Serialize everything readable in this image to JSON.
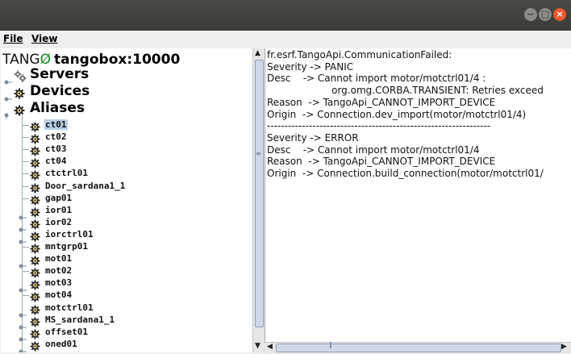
{
  "window": {
    "buttons": {
      "minimize": "−",
      "maximize": "□",
      "close": "×"
    },
    "colors": {
      "titlebar": "#3e3e3b",
      "close": "#e9592c"
    }
  },
  "menubar": {
    "file": "File",
    "view": "View"
  },
  "tree": {
    "logo": "TANGO",
    "root": "tangobox:10000",
    "categories": [
      {
        "label": "Servers",
        "icon": "servers-icon"
      },
      {
        "label": "Devices",
        "icon": "gear-icon"
      },
      {
        "label": "Aliases",
        "icon": "gear-icon"
      }
    ],
    "aliases": [
      {
        "label": "ct01",
        "expandable": false,
        "selected": true
      },
      {
        "label": "ct02",
        "expandable": false
      },
      {
        "label": "ct03",
        "expandable": false
      },
      {
        "label": "ct04",
        "expandable": false
      },
      {
        "label": "ctctrl01",
        "expandable": false
      },
      {
        "label": "Door_sardana1_1",
        "expandable": false
      },
      {
        "label": "gap01",
        "expandable": false
      },
      {
        "label": "ior01",
        "expandable": true
      },
      {
        "label": "ior02",
        "expandable": true
      },
      {
        "label": "iorctrl01",
        "expandable": true
      },
      {
        "label": "mntgrp01",
        "expandable": false
      },
      {
        "label": "mot01",
        "expandable": true
      },
      {
        "label": "mot02",
        "expandable": false
      },
      {
        "label": "mot03",
        "expandable": true
      },
      {
        "label": "mot04",
        "expandable": false
      },
      {
        "label": "motctrl01",
        "expandable": true
      },
      {
        "label": "MS_sardana1_1",
        "expandable": true
      },
      {
        "label": "offset01",
        "expandable": true
      },
      {
        "label": "oned01",
        "expandable": true
      }
    ]
  },
  "error_panel": {
    "lines": [
      "fr.esrf.TangoApi.CommunicationFailed:",
      "Severity -> PANIC",
      "Desc    -> Cannot import motor/motctrl01/4 :",
      "                     org.omg.CORBA.TRANSIENT: Retries exceed",
      "Reason  -> TangoApi_CANNOT_IMPORT_DEVICE",
      "Origin  -> Connection.dev_import(motor/motctrl01/4)",
      "----------------------------------------------------------------",
      "Severity -> ERROR",
      "Desc    -> Cannot import motor/motctrl01/4",
      "Reason  -> TangoApi_CANNOT_IMPORT_DEVICE",
      "Origin  -> Connection.build_connection(motor/motctrl01/"
    ]
  }
}
